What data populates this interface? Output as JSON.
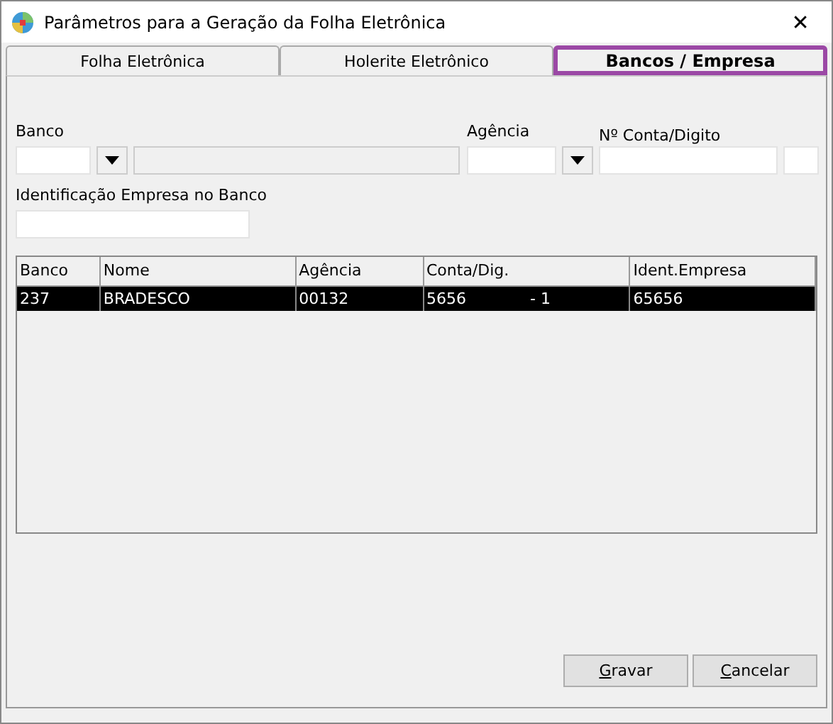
{
  "window": {
    "title": "Parâmetros para a Geração da Folha Eletrônica",
    "close": "✕"
  },
  "tabs": [
    {
      "label": "Folha Eletrônica",
      "selected": false,
      "highlighted": false
    },
    {
      "label": "Holerite Eletrônico",
      "selected": false,
      "highlighted": false
    },
    {
      "label": "Bancos / Empresa",
      "selected": true,
      "highlighted": true
    }
  ],
  "form": {
    "banco_label": "Banco",
    "agencia_label": "Agência",
    "conta_label": "Nº Conta/Digito",
    "ident_label": "Identificação Empresa no Banco"
  },
  "table": {
    "columns": [
      "Banco",
      "Nome",
      "Agência",
      "Conta/Dig.",
      "Ident.Empresa"
    ],
    "rows": [
      {
        "selected": true,
        "banco": "237",
        "nome": "BRADESCO",
        "agencia": "00132",
        "conta": "5656",
        "digito": "- 1",
        "ident": "65656"
      }
    ]
  },
  "buttons": [
    "Gravar",
    "Cancelar"
  ]
}
